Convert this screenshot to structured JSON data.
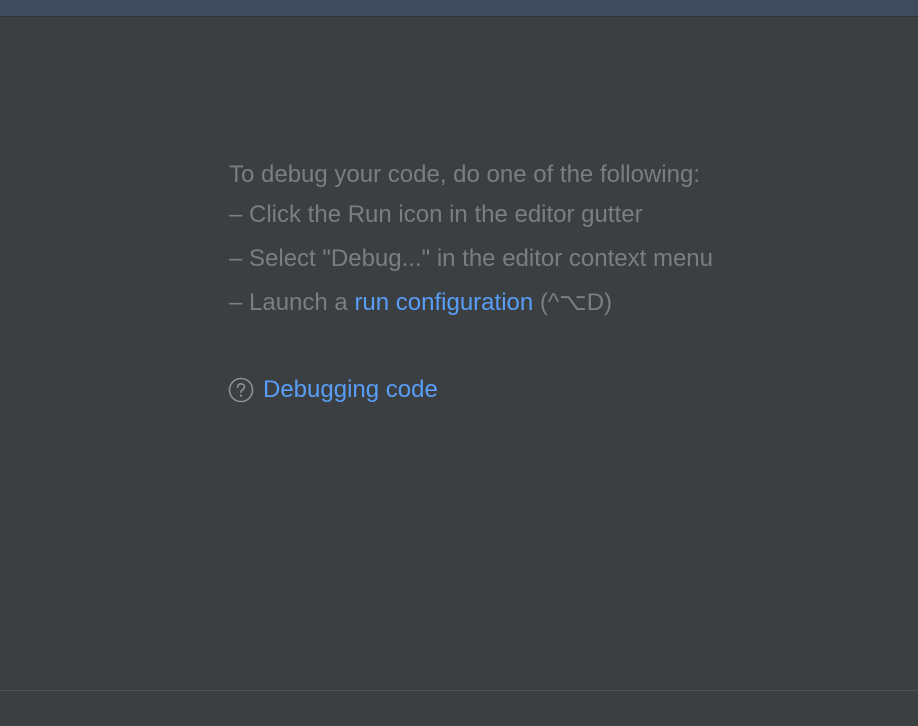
{
  "instructions": {
    "heading": "To debug your code, do one of the following:",
    "item1": "– Click the Run icon in the editor gutter",
    "item2": "– Select \"Debug...\" in the editor context menu",
    "item3_prefix": "– Launch a ",
    "item3_link": "run configuration",
    "item3_shortcut": " (^⌥D)"
  },
  "help": {
    "icon": "question-circle-icon",
    "link_label": "Debugging code"
  },
  "colors": {
    "background": "#3c3f41",
    "text": "#7b7e80",
    "link": "#589df6",
    "top_bar": "#3d4b5c"
  }
}
